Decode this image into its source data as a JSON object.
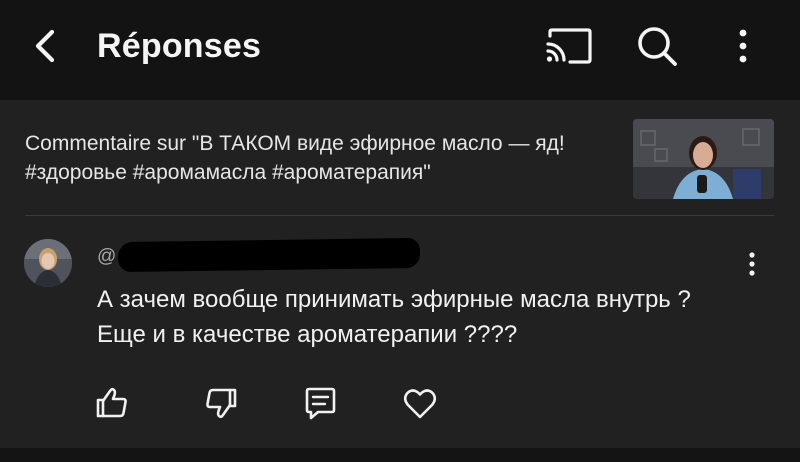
{
  "header": {
    "title": "Réponses",
    "back_icon": "chevron-left-icon",
    "cast_icon": "cast-icon",
    "search_icon": "search-icon",
    "more_icon": "vertical-dots-icon"
  },
  "context": {
    "text": "Commentaire sur \"В ТАКОМ виде эфирное масло — яд! #здоровье #аромамасла #ароматерапия\""
  },
  "comment": {
    "handle_prefix": "@",
    "text": "А зачем вообще принимать эфирные масла внутрь ? Еще и в качестве ароматерапии ????",
    "actions": {
      "like_icon": "thumbs-up-icon",
      "dislike_icon": "thumbs-down-icon",
      "reply_icon": "comment-icon",
      "heart_icon": "heart-icon"
    }
  },
  "colors": {
    "topbar_bg": "#131313",
    "page_bg": "#212121",
    "text_primary": "#f1f1f1",
    "text_secondary": "#a8a8a8"
  }
}
